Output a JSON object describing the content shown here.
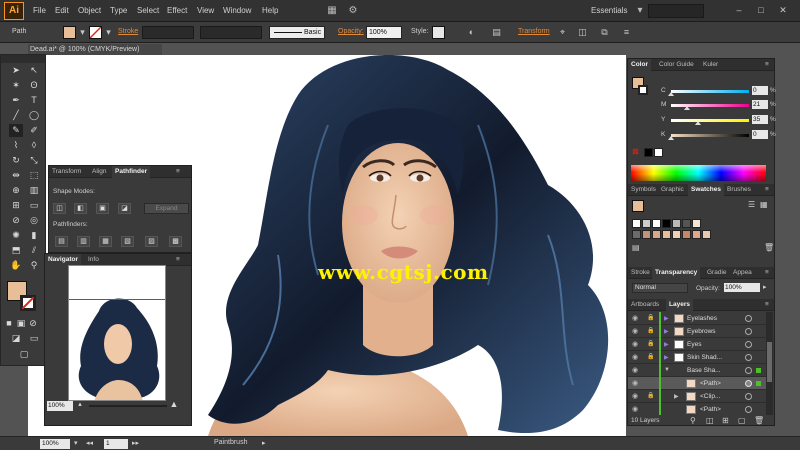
{
  "menubar": {
    "app_icon": "Ai",
    "menus": [
      "File",
      "Edit",
      "Object",
      "Type",
      "Select",
      "Effect",
      "View",
      "Window",
      "Help"
    ],
    "workspace": "Essentials",
    "icons": [
      "arrange-docs-icon",
      "gpu-icon",
      "minimize-icon",
      "maximize-icon",
      "close-icon"
    ]
  },
  "controlbar": {
    "selection_type": "Path",
    "stroke_label": "Stroke",
    "brush_label": "Basic",
    "opacity_label": "Opacity:",
    "opacity_value": "100%",
    "style_label": "Style:",
    "transform_label": "Transform",
    "fill_color": "#e7be98"
  },
  "document": {
    "tab_title": "Dead.ai* @ 100% (CMYK/Preview)"
  },
  "watermark": "www.cgtsj.com",
  "pathfinder_panel": {
    "tabs": [
      "Transform",
      "Align",
      "Pathfinder"
    ],
    "active_tab": "Pathfinder",
    "shape_modes_label": "Shape Modes:",
    "pathfinders_label": "Pathfinders:",
    "expand_label": "Expand"
  },
  "navigator_panel": {
    "tabs": [
      "Navigator",
      "Info"
    ],
    "zoom_value": "100%"
  },
  "color_panel": {
    "tabs": [
      "Color",
      "Color Guide",
      "Kuler"
    ],
    "channels": [
      {
        "label": "C",
        "value": "0",
        "unit": "%",
        "level": 0
      },
      {
        "label": "M",
        "value": "21",
        "unit": "%",
        "level": 0.21
      },
      {
        "label": "Y",
        "value": "35",
        "unit": "%",
        "level": 0.35
      },
      {
        "label": "K",
        "value": "0",
        "unit": "%",
        "level": 0
      }
    ]
  },
  "swatches_panel": {
    "tabs": [
      "Symbols",
      "Graphic",
      "Swatches",
      "Brushes"
    ],
    "active_tab": "Swatches"
  },
  "transparency_panel": {
    "tabs": [
      "Stroke",
      "Transparency",
      "Gradie",
      "Appea"
    ],
    "active_tab": "Transparency",
    "blend_mode": "Normal",
    "opacity_label": "Opacity:",
    "opacity_value": "100%"
  },
  "layers_panel": {
    "tabs": [
      "Artboards",
      "Layers"
    ],
    "active_tab": "Layers",
    "rows": [
      {
        "name": "Eyelashes",
        "indent": 0
      },
      {
        "name": "Eyebrows",
        "indent": 0
      },
      {
        "name": "Eyes",
        "indent": 0
      },
      {
        "name": "Skin Shad...",
        "indent": 0
      },
      {
        "name": "Base Sha...",
        "indent": 0
      },
      {
        "name": "<Path>",
        "indent": 1
      },
      {
        "name": "<Clip...",
        "indent": 1
      },
      {
        "name": "<Path>",
        "indent": 1
      }
    ],
    "count_label": "10 Layers"
  },
  "statusbar": {
    "zoom": "100%",
    "artboard": "1",
    "current_tool": "Paintbrush"
  },
  "colors": {
    "accent_orange": "#f7931e",
    "selection_red": "#e0261b",
    "layer_green": "#4fbf2a",
    "hair_dark": "#16223a",
    "skin": "#e9c2a0"
  }
}
